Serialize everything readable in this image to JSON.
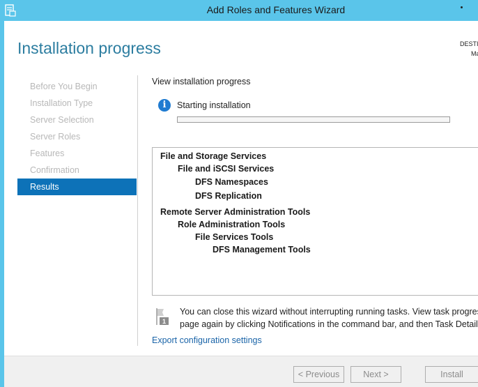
{
  "window": {
    "title": "Add Roles and Features Wizard",
    "app_icon": "server-manager-icon"
  },
  "page": {
    "heading": "Installation progress",
    "destination_line1": "DESTI",
    "destination_line2": "Ma"
  },
  "nav": {
    "items": [
      {
        "label": "Before You Begin",
        "active": false
      },
      {
        "label": "Installation Type",
        "active": false
      },
      {
        "label": "Server Selection",
        "active": false
      },
      {
        "label": "Server Roles",
        "active": false
      },
      {
        "label": "Features",
        "active": false
      },
      {
        "label": "Confirmation",
        "active": false
      },
      {
        "label": "Results",
        "active": true
      }
    ]
  },
  "main": {
    "section_label": "View installation progress",
    "status_icon": "info-icon",
    "status_text": "Starting installation",
    "progress": 0,
    "features": [
      {
        "label": "File and Storage Services",
        "level": 0
      },
      {
        "label": "File and iSCSI Services",
        "level": 1
      },
      {
        "label": "DFS Namespaces",
        "level": 2
      },
      {
        "label": "DFS Replication",
        "level": 2
      },
      {
        "label": "Remote Server Administration Tools",
        "level": 0
      },
      {
        "label": "Role Administration Tools",
        "level": 1
      },
      {
        "label": "File Services Tools",
        "level": 2
      },
      {
        "label": "DFS Management Tools",
        "level": 3
      }
    ],
    "note_icon": "notification-flag-icon",
    "note_line1": "You can close this wizard without interrupting running tasks. View task progress o",
    "note_line2": "page again by clicking Notifications in the command bar, and then Task Details.",
    "note_badge": "1",
    "export_link": "Export configuration settings"
  },
  "footer": {
    "previous_label": "< Previous",
    "next_label": "Next >",
    "install_label": "Install"
  }
}
